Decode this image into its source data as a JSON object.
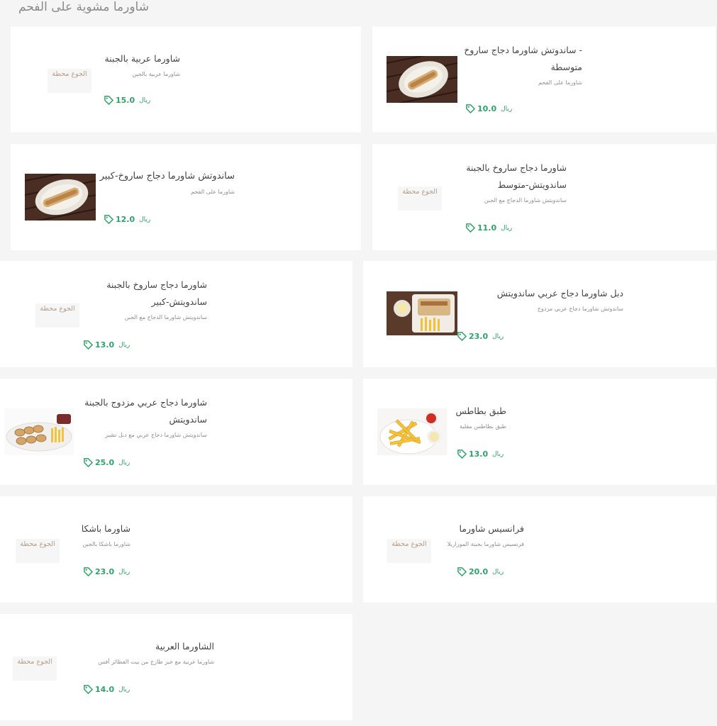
{
  "section_title": "شاورما مشوية على الفحم",
  "placeholder_text": "الجوع محطة",
  "colors": {
    "price": "#2fa36a",
    "placeholder_text": "#b29c87",
    "background": "#f5f5f5"
  },
  "items": [
    {
      "name": "شاورما عربية بالجبنة",
      "description": "شاورما عربية بالجبن",
      "price": "15.0",
      "currency": "ريال",
      "image": "placeholder"
    },
    {
      "name": "- ساندوتش شاورما دجاج ساروخ متوسطة",
      "description": "شاورما على الفحم",
      "price": "10.0",
      "currency": "ريال",
      "image": "shawarma-on-tray"
    },
    {
      "name": "ساندوتش شاورما دجاج ساروخ-كبير",
      "description": "شاورما على الفحم",
      "price": "12.0",
      "currency": "ريال",
      "image": "shawarma-on-tray"
    },
    {
      "name": "شاورما دجاج ساروخ بالجبنة ساندويتش-متوسط",
      "description": "ساندويتش شاورما الدجاج مع الجبن",
      "price": "11.0",
      "currency": "ريال",
      "image": "placeholder"
    },
    {
      "name": "شاورما دجاج ساروخ بالجبنة ساندويتش-كبير",
      "description": "ساندويتش شاورما الدجاج مع الجبن",
      "price": "13.0",
      "currency": "ريال",
      "image": "placeholder"
    },
    {
      "name": "دبل شاورما دجاج عربي ساندويتش",
      "description": "ساندوتش شاورما دجاج عربي مزدوج",
      "price": "23.0",
      "currency": "ريال",
      "image": "shawarma-meal-box"
    },
    {
      "name": "شاورما دجاج عربي مزدوج بالجبنة ساندويتش",
      "description": "ساندويتش شاورما دجاج عربي مع دبل تشيز",
      "price": "25.0",
      "currency": "ريال",
      "image": "shawarma-platter"
    },
    {
      "name": "طبق بطاطس",
      "description": "طبق بطاطس مقلية",
      "price": "13.0",
      "currency": "ريال",
      "image": "french-fries-plate"
    },
    {
      "name": "شاورما باشكا",
      "description": "شاورما باشكا بالجبن",
      "price": "23.0",
      "currency": "ريال",
      "image": "placeholder"
    },
    {
      "name": "فرانسيس شاورما",
      "description": "فرنسيس شاورما بجبنة الموزاريلا",
      "price": "20.0",
      "currency": "ريال",
      "image": "placeholder"
    },
    {
      "name": "الشاورما العربية",
      "description": "شاورما عربية مع خبز طازج من بيت الفطائر أفس",
      "price": "14.0",
      "currency": "ريال",
      "image": "placeholder"
    }
  ]
}
